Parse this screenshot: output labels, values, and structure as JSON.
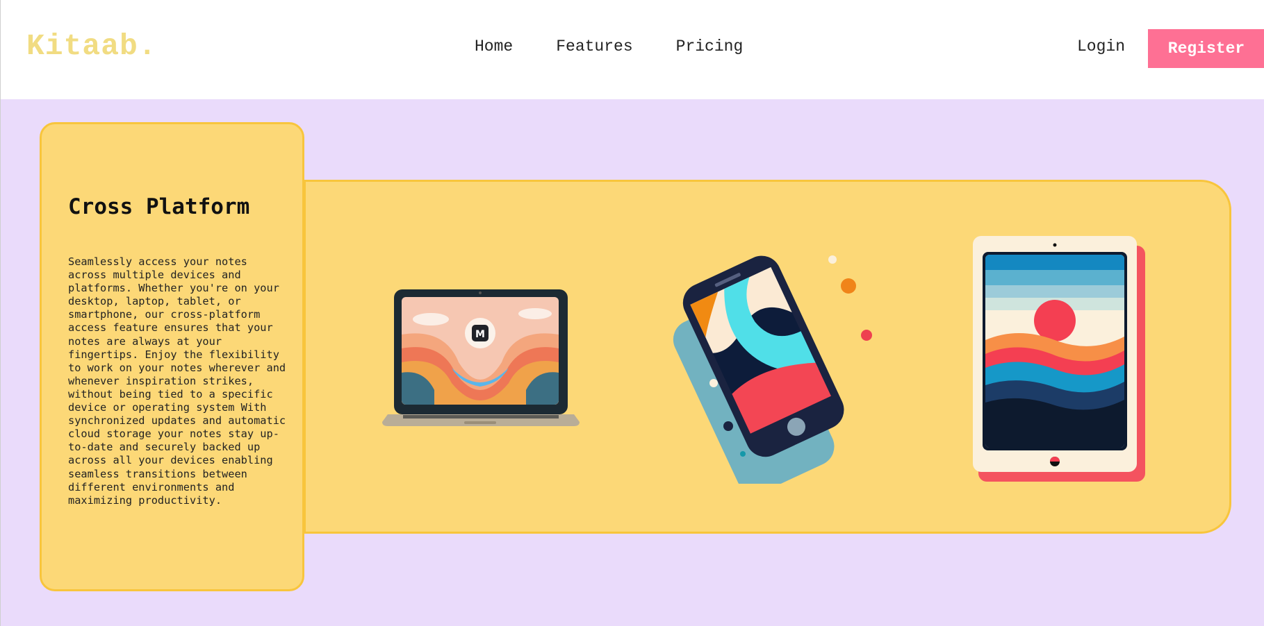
{
  "header": {
    "logo": "Kitaab.",
    "nav": [
      {
        "label": "Home"
      },
      {
        "label": "Features"
      },
      {
        "label": "Pricing"
      }
    ],
    "login_label": "Login",
    "register_label": "Register"
  },
  "feature": {
    "title": "Cross Platform",
    "description": "Seamlessly access your notes across multiple devices and platforms. Whether you're on your desktop, laptop, tablet, or smartphone, our cross-platform access feature ensures that your notes are always at your fingertips. Enjoy the flexibility to work on your notes wherever and whenever inspiration strikes, without being tied to a specific device or operating system With synchronized updates and automatic cloud storage your notes stay up-to-date and securely backed up across all your devices enabling seamless transitions between different environments and maximizing productivity."
  },
  "colors": {
    "logo": "#f1dc82",
    "register_bg": "#fe7094",
    "page_bg": "#eadbfb",
    "panel_bg": "#fcd877",
    "panel_border": "#f8c53c"
  },
  "icons": [
    "laptop-illustration",
    "smartphone-illustration",
    "tablet-illustration"
  ]
}
